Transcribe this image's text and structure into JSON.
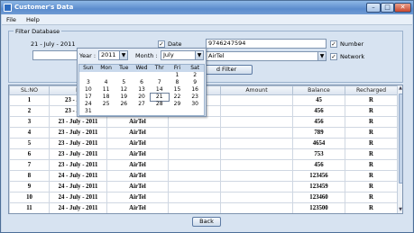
{
  "window": {
    "title": "Customer's Data",
    "minimize": "–",
    "maximize": "□",
    "close": "✕"
  },
  "menu": [
    "File",
    "Help"
  ],
  "filter": {
    "legend": "Filter Database",
    "date_value": "21 - July - 2011",
    "date_label": "Date",
    "number_value": "9746247594",
    "number_label": "Number",
    "network_value": "AirTel",
    "network_label": "Network",
    "filter_button": "d  Filter"
  },
  "calendar": {
    "year_label": "Year :",
    "year_value": "2011",
    "month_label": "Month :",
    "month_value": "July",
    "weekdays": [
      "Sun",
      "Mon",
      "Tue",
      "Wed",
      "Thr",
      "Fri",
      "Sat"
    ],
    "weeks": [
      [
        "",
        "",
        "",
        "",
        "",
        "1",
        "2"
      ],
      [
        "3",
        "4",
        "5",
        "6",
        "7",
        "8",
        "9"
      ],
      [
        "10",
        "11",
        "12",
        "13",
        "14",
        "15",
        "16"
      ],
      [
        "17",
        "18",
        "19",
        "20",
        "21",
        "22",
        "23"
      ],
      [
        "24",
        "25",
        "26",
        "27",
        "28",
        "29",
        "30"
      ],
      [
        "31",
        "",
        "",
        "",
        "",
        "",
        ""
      ]
    ],
    "selected_day": "21"
  },
  "table": {
    "columns": [
      "SL:NO",
      "D",
      "",
      "",
      "Amount",
      "Balance",
      "Recharged"
    ],
    "rows": [
      [
        "1",
        "23 - July -",
        "",
        "",
        "",
        "45",
        "R"
      ],
      [
        "2",
        "23 - July -",
        "",
        "",
        "",
        "456",
        "R"
      ],
      [
        "3",
        "23 - July - 2011",
        "AirTel",
        "",
        "",
        "456",
        "R"
      ],
      [
        "4",
        "23 - July - 2011",
        "AirTel",
        "",
        "",
        "789",
        "R"
      ],
      [
        "5",
        "23 - July - 2011",
        "AirTel",
        "",
        "",
        "4654",
        "R"
      ],
      [
        "6",
        "23 - July - 2011",
        "AirTel",
        "",
        "",
        "753",
        "R"
      ],
      [
        "7",
        "23 - July - 2011",
        "AirTel",
        "",
        "",
        "456",
        "R"
      ],
      [
        "8",
        "24 - July - 2011",
        "AirTel",
        "",
        "",
        "123456",
        "R"
      ],
      [
        "9",
        "24 - July - 2011",
        "AirTel",
        "",
        "",
        "123459",
        "R"
      ],
      [
        "10",
        "24 - July - 2011",
        "AirTel",
        "",
        "",
        "123460",
        "R"
      ],
      [
        "11",
        "24 - July - 2011",
        "AirTel",
        "",
        "",
        "123500",
        "R"
      ],
      [
        "12",
        "24 - July - 2011",
        "AirTel",
        "9746247594",
        "50",
        "123500",
        "R"
      ]
    ]
  },
  "back_button": "Back"
}
